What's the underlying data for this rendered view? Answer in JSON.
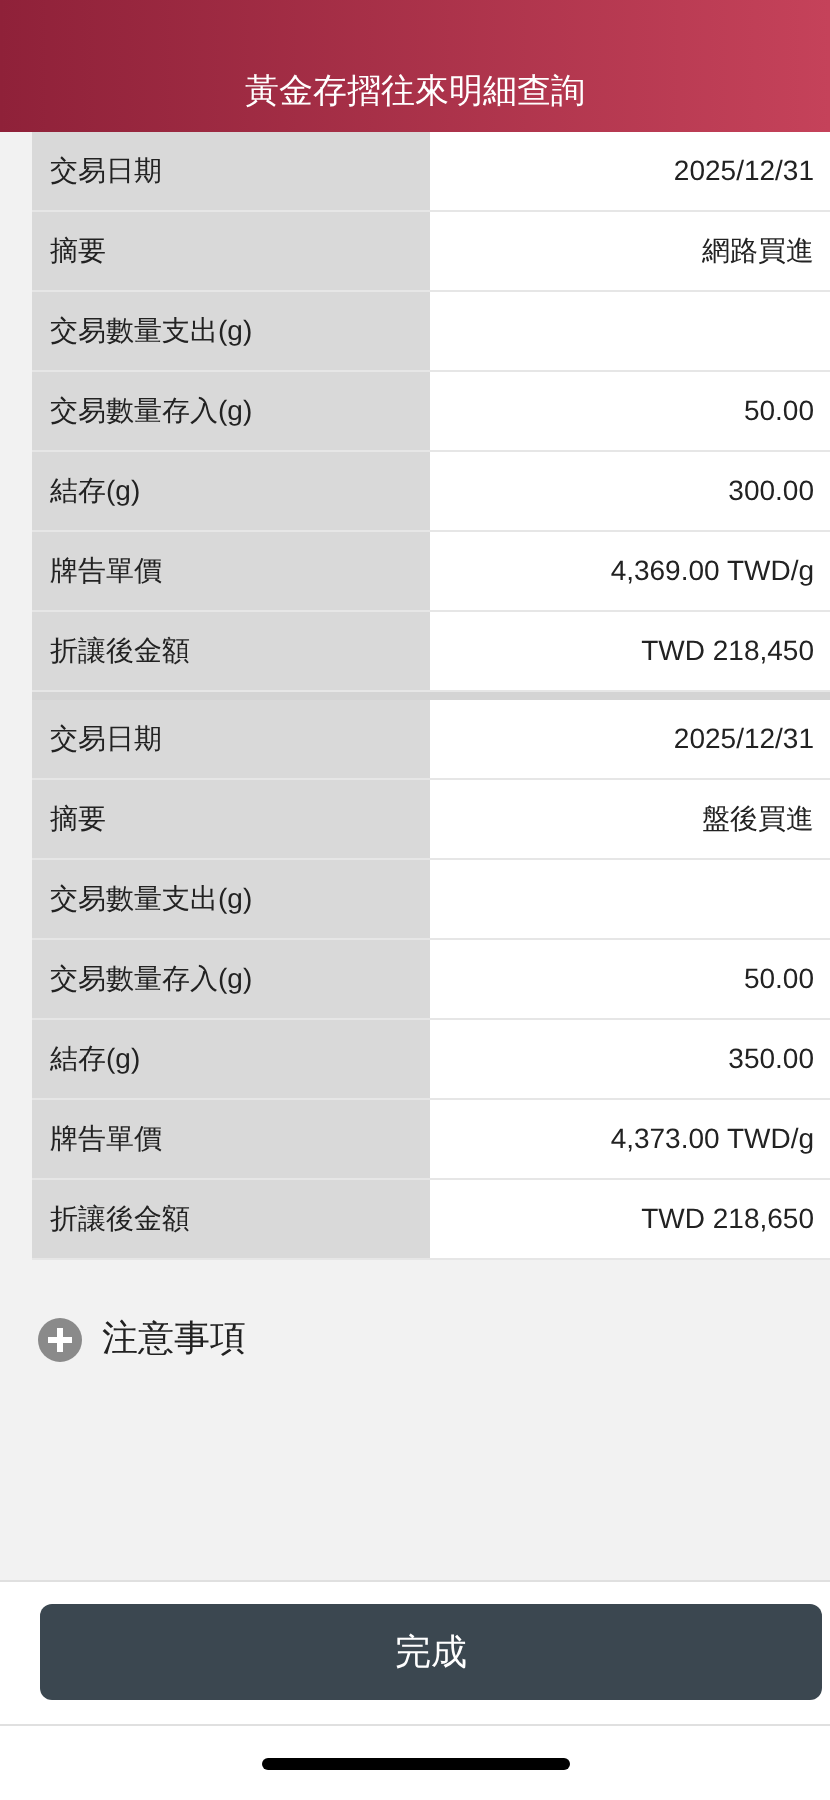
{
  "header": {
    "title": "黃金存摺往來明細查詢"
  },
  "records": [
    {
      "rows": [
        {
          "label": "交易日期",
          "value": "2025/12/31"
        },
        {
          "label": "摘要",
          "value": "網路買進"
        },
        {
          "label": "交易數量支出(g)"
        },
        {
          "label": "交易數量存入(g)",
          "value": "50.00"
        },
        {
          "label": "結存(g)",
          "value": "300.00"
        },
        {
          "label": "牌告單價",
          "value": "4,369.00 TWD/g"
        },
        {
          "label": "折讓後金額",
          "value": "TWD 218,450"
        }
      ]
    },
    {
      "rows": [
        {
          "label": "交易日期",
          "value": "2025/12/31"
        },
        {
          "label": "摘要",
          "value": "盤後買進"
        },
        {
          "label": "交易數量支出(g)"
        },
        {
          "label": "交易數量存入(g)",
          "value": "50.00"
        },
        {
          "label": "結存(g)",
          "value": "350.00"
        },
        {
          "label": "牌告單價",
          "value": "4,373.00 TWD/g"
        },
        {
          "label": "折讓後金額",
          "value": "TWD 218,650"
        }
      ]
    }
  ],
  "notice": {
    "label": "注意事項",
    "expanded": false
  },
  "done_button": "完成"
}
